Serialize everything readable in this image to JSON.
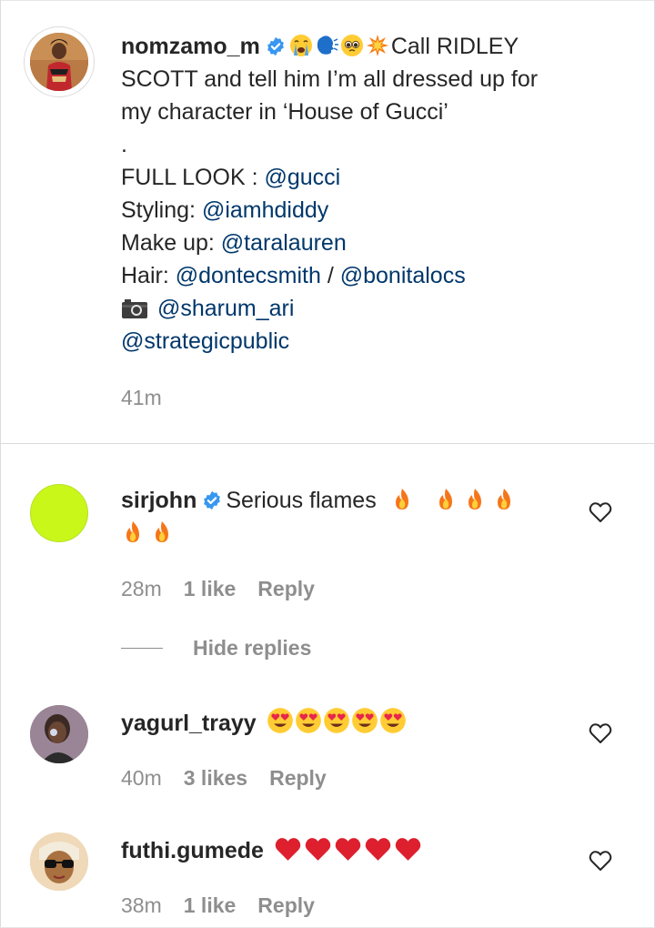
{
  "caption": {
    "username": "nomzamo_m",
    "line1_text": "Call RIDLEY",
    "line2": "SCOTT and tell him I’m all dressed up for",
    "line3": "my character in ‘House of Gucci’",
    "dot": ".",
    "full_look_label": "FULL LOOK : ",
    "full_look_mention": "@gucci",
    "styling_label": "Styling: ",
    "styling_mention": "@iamhdiddy",
    "makeup_label": "Make up: ",
    "makeup_mention": "@taralauren",
    "hair_label": "Hair: ",
    "hair_mention_1": "@dontecsmith",
    "hair_sep": " / ",
    "hair_mention_2": "@bonitalocs",
    "photo_mention": "@sharum_ari",
    "pr_mention": "@strategicpublic",
    "timestamp": "41m",
    "emojis": [
      "loudly-crying-face",
      "speaking-head",
      "pleading-face",
      "collision"
    ]
  },
  "comments": [
    {
      "username": "sirjohn",
      "verified": true,
      "text": "Serious flames",
      "emoji_count": 6,
      "emoji": "fire",
      "time": "28m",
      "likes": "1 like",
      "reply": "Reply"
    },
    {
      "username": "yagurl_trayy",
      "verified": false,
      "emoji_count": 5,
      "emoji": "smiling-face-with-heart-eyes",
      "time": "40m",
      "likes": "3 likes",
      "reply": "Reply"
    },
    {
      "username": "futhi.gumede",
      "verified": false,
      "emoji_count": 5,
      "emoji": "red-heart",
      "time": "38m",
      "likes": "1 like",
      "reply": "Reply"
    }
  ],
  "hide_replies": "Hide replies",
  "colors": {
    "text": "#262626",
    "mention": "#00376b",
    "muted": "#8e8e8e",
    "verified": "#3897f0",
    "sirjohn_avatar": "#c9f719"
  }
}
